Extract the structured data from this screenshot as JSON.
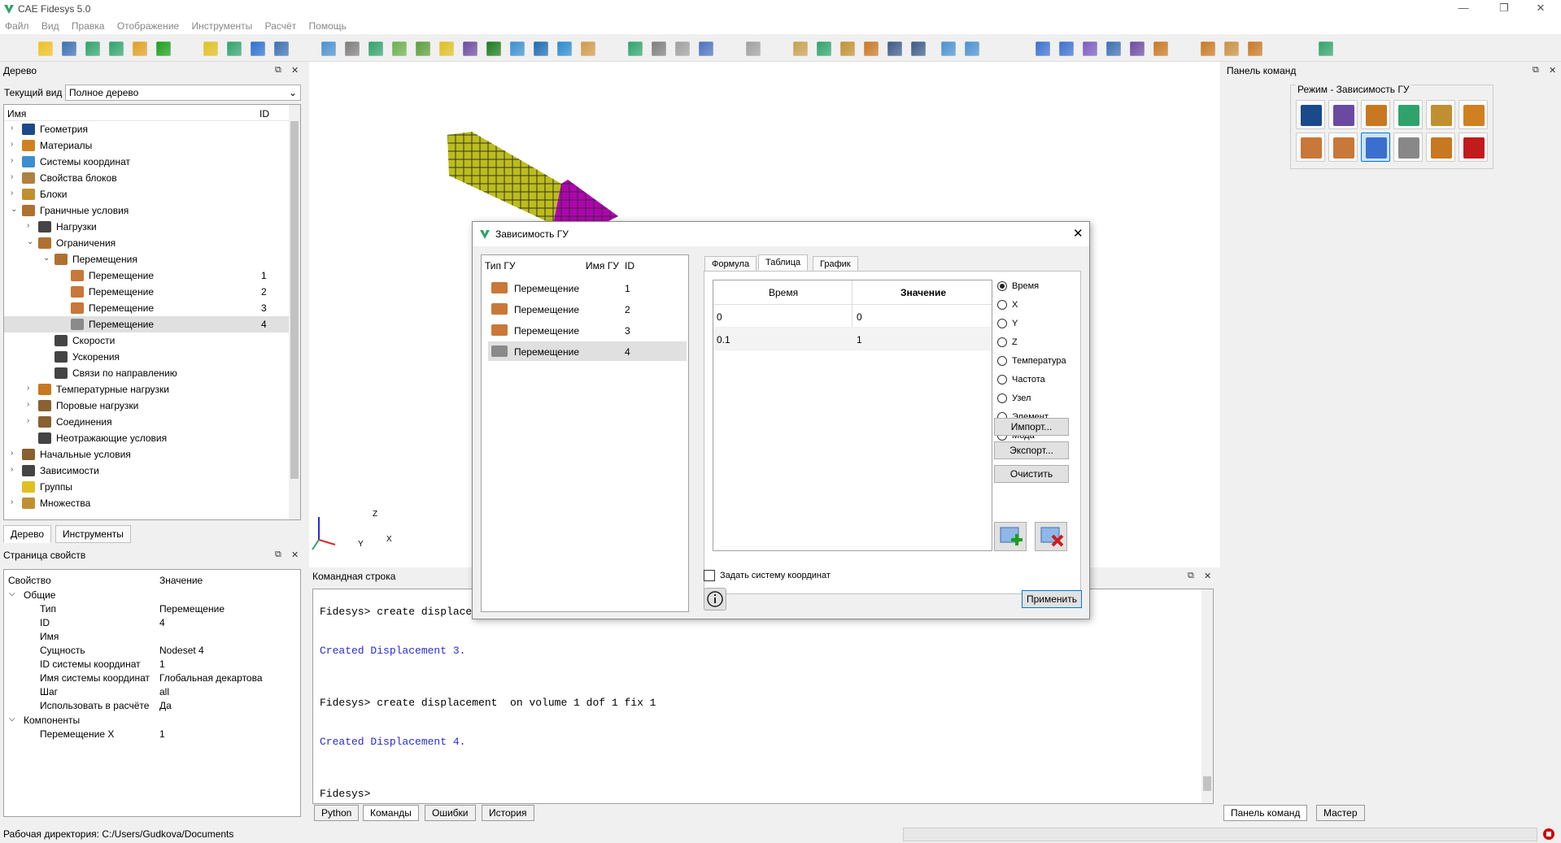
{
  "window": {
    "title": "CAE Fidesys 5.0",
    "min": "—",
    "restore": "❐",
    "close": "✕"
  },
  "menu": [
    "Файл",
    "Вид",
    "Правка",
    "Отображение",
    "Инструменты",
    "Расчёт",
    "Помощь"
  ],
  "tree_panel": {
    "title": "Дерево",
    "current_view_label": "Текущий вид",
    "current_view_value": "Полное дерево",
    "col_name": "Имя",
    "col_id": "ID",
    "rows": [
      {
        "label": "Геометрия",
        "id": ""
      },
      {
        "label": "Материалы",
        "id": ""
      },
      {
        "label": "Системы координат",
        "id": ""
      },
      {
        "label": "Свойства блоков",
        "id": ""
      },
      {
        "label": "Блоки",
        "id": ""
      },
      {
        "label": "Граничные условия",
        "id": ""
      },
      {
        "label": "Нагрузки",
        "id": ""
      },
      {
        "label": "Ограничения",
        "id": ""
      },
      {
        "label": "Перемещения",
        "id": ""
      },
      {
        "label": "Перемещение",
        "id": "1"
      },
      {
        "label": "Перемещение",
        "id": "2"
      },
      {
        "label": "Перемещение",
        "id": "3"
      },
      {
        "label": "Перемещение",
        "id": "4"
      },
      {
        "label": "Скорости",
        "id": ""
      },
      {
        "label": "Ускорения",
        "id": ""
      },
      {
        "label": "Связи по направлению",
        "id": ""
      },
      {
        "label": "Температурные нагрузки",
        "id": ""
      },
      {
        "label": "Поровые нагрузки",
        "id": ""
      },
      {
        "label": "Соединения",
        "id": ""
      },
      {
        "label": "Неотражающие условия",
        "id": ""
      },
      {
        "label": "Начальные условия",
        "id": ""
      },
      {
        "label": "Зависимости",
        "id": ""
      },
      {
        "label": "Группы",
        "id": ""
      },
      {
        "label": "Множества",
        "id": ""
      }
    ],
    "tabs": [
      "Дерево",
      "Инструменты"
    ]
  },
  "props_panel": {
    "title": "Страница свойств",
    "col_prop": "Свойство",
    "col_value": "Значение",
    "group_general": "Общие",
    "rows": [
      {
        "k": "Тип",
        "v": "Перемещение"
      },
      {
        "k": "ID",
        "v": "4"
      },
      {
        "k": "Имя",
        "v": ""
      },
      {
        "k": "Сущность",
        "v": "Nodeset 4"
      },
      {
        "k": "ID системы координат",
        "v": "1"
      },
      {
        "k": "Имя системы координат",
        "v": "Глобальная декартова"
      },
      {
        "k": "Шаг",
        "v": "all"
      },
      {
        "k": "Использовать в расчёте",
        "v": "Да"
      }
    ],
    "group_components": "Компоненты",
    "comp_rows": [
      {
        "k": "Перемещение X",
        "v": "1"
      }
    ]
  },
  "dialog": {
    "title": "Зависимость ГУ",
    "list_headers": [
      "Тип ГУ",
      "Имя ГУ",
      "ID"
    ],
    "list_rows": [
      {
        "type": "Перемещение",
        "id": "1"
      },
      {
        "type": "Перемещение",
        "id": "2"
      },
      {
        "type": "Перемещение",
        "id": "3"
      },
      {
        "type": "Перемещение",
        "id": "4"
      }
    ],
    "tabs": [
      "Формула",
      "Таблица",
      "График"
    ],
    "table_headers": [
      "Время",
      "Значение"
    ],
    "table_rows": [
      [
        "0",
        "0"
      ],
      [
        "0.1",
        "1"
      ]
    ],
    "radios": [
      "Время",
      "X",
      "Y",
      "Z",
      "Температура",
      "Частота",
      "Узел",
      "Элемент",
      "Мода"
    ],
    "btn_import": "Импорт...",
    "btn_export": "Экспорт...",
    "btn_clear": "Очистить",
    "checkbox_cs": "Задать систему координат",
    "btn_apply": "Применить"
  },
  "command_panel": {
    "title": "Командная строка",
    "lines": [
      {
        "t": "Fidesys> create displace",
        "kind": "cmd"
      },
      {
        "t": "Created Displacement 3.",
        "kind": "out"
      },
      {
        "t": "Fidesys> create displacement  on volume 1 dof 1 fix 1",
        "kind": "cmd"
      },
      {
        "t": "Created Displacement 4.",
        "kind": "out"
      },
      {
        "t": "Fidesys>",
        "kind": "cmd"
      }
    ],
    "tabs": [
      "Python",
      "Команды",
      "Ошибки",
      "История"
    ]
  },
  "right_panel": {
    "title": "Панель команд",
    "mode": "Режим - Зависимость ГУ",
    "tabs": [
      "Панель команд",
      "Мастер"
    ]
  },
  "status": {
    "workdir": "Рабочая директория: C:/Users/Gudkova/Documents"
  },
  "axes": {
    "z": "Z",
    "x": "X",
    "y": "Y"
  }
}
